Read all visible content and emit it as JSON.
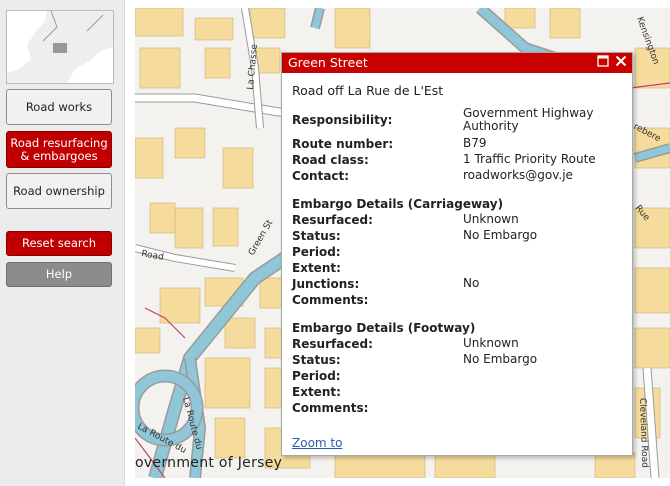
{
  "sidebar": {
    "buttons": {
      "road_works": "Road works",
      "road_resurfacing": "Road resurfacing & embargoes",
      "road_ownership": "Road ownership",
      "reset_search": "Reset search",
      "help": "Help"
    }
  },
  "map": {
    "labels": {
      "la_chasse": "La Chasse",
      "green_st": "Green St",
      "road_left": "Road",
      "la_route": "La Route du",
      "la_route_b": "La Route du",
      "cleveland": "Cleveland Road",
      "rue_right": "Rue",
      "kensington": "Kensington",
      "ebe": "rebere"
    },
    "attribution": "overnment of Jersey"
  },
  "popup": {
    "title": "Green Street",
    "subtitle": "Road off La Rue de L'Est",
    "fields": [
      {
        "k": "Responsibility:",
        "v": "Government Highway Authority"
      },
      {
        "k": "Route number:",
        "v": "B79"
      },
      {
        "k": "Road class:",
        "v": "1 Traffic Priority Route"
      },
      {
        "k": "Contact:",
        "v": "roadworks@gov.je"
      }
    ],
    "carriageway": {
      "heading": "Embargo Details (Carriageway)",
      "rows": [
        {
          "k": "Resurfaced:",
          "v": "Unknown"
        },
        {
          "k": "Status:",
          "v": "No Embargo"
        },
        {
          "k": "Period:",
          "v": ""
        },
        {
          "k": "Extent:",
          "v": ""
        },
        {
          "k": "Junctions:",
          "v": "No"
        },
        {
          "k": "Comments:",
          "v": ""
        }
      ]
    },
    "footway": {
      "heading": "Embargo Details (Footway)",
      "rows": [
        {
          "k": "Resurfaced:",
          "v": "Unknown"
        },
        {
          "k": "Status:",
          "v": "No Embargo"
        },
        {
          "k": "Period:",
          "v": ""
        },
        {
          "k": "Extent:",
          "v": ""
        },
        {
          "k": "Comments:",
          "v": ""
        }
      ]
    },
    "zoom_link": "Zoom to"
  },
  "colors": {
    "accent_red": "#c80000",
    "building": "#f6dc9c",
    "road_blue": "#8fc7d8",
    "road_casing": "#9a9a9a"
  }
}
